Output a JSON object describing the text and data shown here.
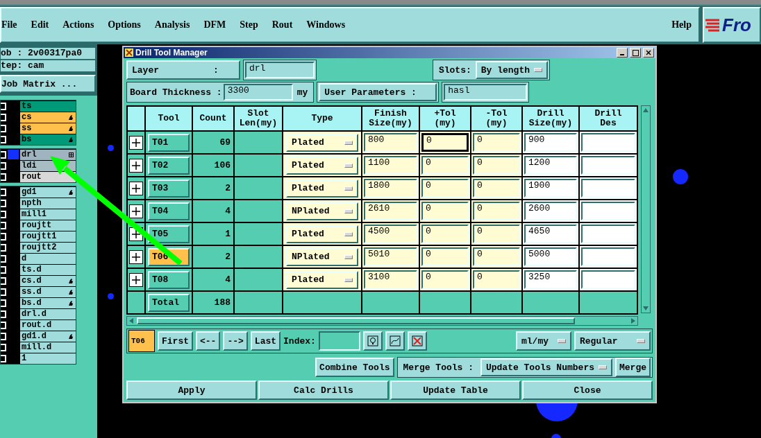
{
  "menu": [
    "File",
    "Edit",
    "Actions",
    "Options",
    "Analysis",
    "DFM",
    "Step",
    "Rout",
    "Windows"
  ],
  "help": "Help",
  "logo": "Fro",
  "job_panel": {
    "job": "ob : 2v00317pa0",
    "step": "tep: cam",
    "matrix_button": "Job Matrix ..."
  },
  "layer_groups": [
    [
      {
        "name": "ts",
        "color": "#009a78",
        "flagged": false,
        "linked": false,
        "checked": false,
        "selected": false
      },
      {
        "name": "cs",
        "color": "#ffc04c",
        "flagged": true,
        "linked": false,
        "checked": false,
        "selected": false
      },
      {
        "name": "ss",
        "color": "#ffc04c",
        "flagged": true,
        "linked": false,
        "checked": false,
        "selected": false
      },
      {
        "name": "bs",
        "color": "#009a78",
        "flagged": true,
        "linked": false,
        "checked": false,
        "selected": false
      }
    ],
    [
      {
        "name": "drl",
        "color": "#a0b4c0",
        "flagged": false,
        "linked": true,
        "checked": false,
        "selected": true
      },
      {
        "name": "ldi",
        "color": "#a8bcc4",
        "flagged": false,
        "linked": false,
        "checked": false,
        "selected": false
      },
      {
        "name": "rout",
        "color": "#d8d8d8",
        "flagged": false,
        "linked": false,
        "checked": false,
        "selected": false
      }
    ],
    [
      {
        "name": "gd1",
        "color": "#a0dcdc",
        "flagged": true,
        "linked": false,
        "checked": false,
        "selected": false
      },
      {
        "name": "npth",
        "color": "#a0dcdc",
        "flagged": false,
        "linked": false,
        "checked": false,
        "selected": false
      },
      {
        "name": "mill1",
        "color": "#a0dcdc",
        "flagged": false,
        "linked": false,
        "checked": false,
        "selected": false
      },
      {
        "name": "roujtt",
        "color": "#a0dcdc",
        "flagged": false,
        "linked": false,
        "checked": false,
        "selected": false
      },
      {
        "name": "roujtt1",
        "color": "#a0dcdc",
        "flagged": false,
        "linked": false,
        "checked": false,
        "selected": false
      },
      {
        "name": "roujtt2",
        "color": "#a0dcdc",
        "flagged": false,
        "linked": false,
        "checked": false,
        "selected": false
      },
      {
        "name": "d",
        "color": "#a0dcdc",
        "flagged": false,
        "linked": false,
        "checked": false,
        "selected": false
      },
      {
        "name": "ts.d",
        "color": "#a0dcdc",
        "flagged": false,
        "linked": false,
        "checked": false,
        "selected": false
      },
      {
        "name": "cs.d",
        "color": "#a0dcdc",
        "flagged": true,
        "linked": false,
        "checked": false,
        "selected": false
      },
      {
        "name": "ss.d",
        "color": "#a0dcdc",
        "flagged": true,
        "linked": false,
        "checked": false,
        "selected": false
      },
      {
        "name": "bs.d",
        "color": "#a0dcdc",
        "flagged": true,
        "linked": false,
        "checked": false,
        "selected": false
      },
      {
        "name": "drl.d",
        "color": "#a0dcdc",
        "flagged": false,
        "linked": false,
        "checked": false,
        "selected": false
      },
      {
        "name": "rout.d",
        "color": "#a0dcdc",
        "flagged": false,
        "linked": false,
        "checked": false,
        "selected": false
      },
      {
        "name": "gd1.d",
        "color": "#a0dcdc",
        "flagged": true,
        "linked": false,
        "checked": false,
        "selected": false
      },
      {
        "name": "mill.d",
        "color": "#a0dcdc",
        "flagged": false,
        "linked": false,
        "checked": false,
        "selected": false
      },
      {
        "name": "1",
        "color": "#a0dcdc",
        "flagged": false,
        "linked": false,
        "checked": false,
        "selected": false
      }
    ]
  ],
  "dialog": {
    "title": "Drill Tool Manager",
    "layer_label": "Layer          :",
    "layer_value": "drl",
    "slots_label": "Slots:",
    "slots_value": "By length",
    "thickness_label": "Board Thickness :",
    "thickness_value": "3300",
    "thickness_unit": "my",
    "user_params_button": "User Parameters :",
    "user_params_value": "hasl"
  },
  "columns": [
    "Tool",
    "Count",
    "Slot\nLen(my)",
    "Type",
    "Finish\nSize(my)",
    "+Tol\n(my)",
    "-Tol\n(my)",
    "Drill\nSize(my)",
    "Drill\nDes"
  ],
  "rows": [
    {
      "tool": "T01",
      "count": "69",
      "type": "Plated",
      "finish": "800",
      "plus_tol": "0",
      "minus_tol": "0",
      "drill_size": "900",
      "selected": false,
      "focused": true
    },
    {
      "tool": "T02",
      "count": "106",
      "type": "Plated",
      "finish": "1100",
      "plus_tol": "0",
      "minus_tol": "0",
      "drill_size": "1200",
      "selected": false,
      "focused": false
    },
    {
      "tool": "T03",
      "count": "2",
      "type": "Plated",
      "finish": "1800",
      "plus_tol": "0",
      "minus_tol": "0",
      "drill_size": "1900",
      "selected": false,
      "focused": false
    },
    {
      "tool": "T04",
      "count": "4",
      "type": "NPlated",
      "finish": "2610",
      "plus_tol": "0",
      "minus_tol": "0",
      "drill_size": "2600",
      "selected": false,
      "focused": false
    },
    {
      "tool": "T05",
      "count": "1",
      "type": "Plated",
      "finish": "4500",
      "plus_tol": "0",
      "minus_tol": "0",
      "drill_size": "4650",
      "selected": false,
      "focused": false
    },
    {
      "tool": "T06",
      "count": "2",
      "type": "NPlated",
      "finish": "5010",
      "plus_tol": "0",
      "minus_tol": "0",
      "drill_size": "5000",
      "selected": true,
      "focused": false
    },
    {
      "tool": "T08",
      "count": "4",
      "type": "Plated",
      "finish": "3100",
      "plus_tol": "0",
      "minus_tol": "0",
      "drill_size": "3250",
      "selected": false,
      "focused": false
    }
  ],
  "total": {
    "label": "Total",
    "count": "188"
  },
  "nav": {
    "current": "T06",
    "buttons": [
      "First",
      "<--",
      "-->",
      "Last"
    ],
    "index_label": "Index:",
    "units": "ml/my",
    "mode": "Regular"
  },
  "merge": {
    "combine_button": "Combine Tools",
    "label": "Merge Tools :",
    "select": "Update Tools Numbers",
    "button": "Merge"
  },
  "actions": [
    "Apply",
    "Calc Drills",
    "Update Table",
    "Close"
  ]
}
